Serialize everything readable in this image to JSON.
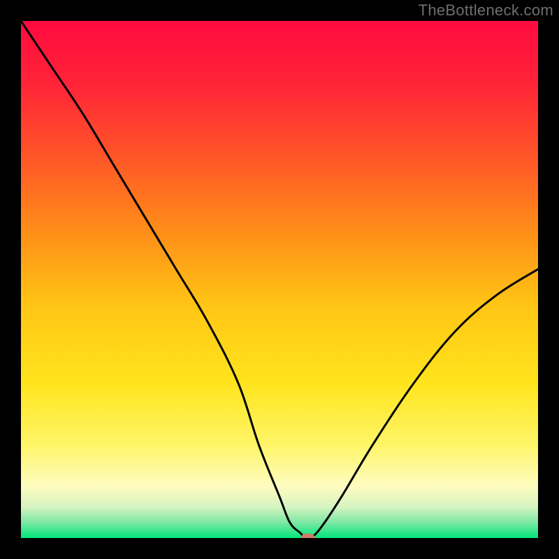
{
  "watermark": "TheBottleneck.com",
  "chart_data": {
    "type": "line",
    "title": "",
    "xlabel": "",
    "ylabel": "",
    "xlim": [
      0,
      100
    ],
    "ylim": [
      0,
      100
    ],
    "background_gradient": {
      "stops": [
        {
          "offset": 0.0,
          "color": "#ff0a3f"
        },
        {
          "offset": 0.12,
          "color": "#ff2338"
        },
        {
          "offset": 0.25,
          "color": "#ff5129"
        },
        {
          "offset": 0.4,
          "color": "#ff8b19"
        },
        {
          "offset": 0.55,
          "color": "#ffc515"
        },
        {
          "offset": 0.7,
          "color": "#ffe41c"
        },
        {
          "offset": 0.82,
          "color": "#fff568"
        },
        {
          "offset": 0.9,
          "color": "#fdfcc0"
        },
        {
          "offset": 0.94,
          "color": "#d6f4c1"
        },
        {
          "offset": 0.97,
          "color": "#7de7a3"
        },
        {
          "offset": 1.0,
          "color": "#00e67b"
        }
      ]
    },
    "series": [
      {
        "name": "curve",
        "x": [
          0,
          6,
          12,
          18,
          24,
          30,
          36,
          42,
          46,
          50,
          52,
          54,
          55,
          56,
          58,
          62,
          68,
          76,
          84,
          92,
          100
        ],
        "y": [
          100,
          91,
          82,
          72,
          62,
          52,
          42,
          30,
          18,
          8,
          3,
          1,
          0,
          0,
          2,
          8,
          18,
          30,
          40,
          47,
          52
        ]
      }
    ],
    "marker": {
      "x": 55.5,
      "y": 0,
      "rx": 1.4,
      "ry": 0.9,
      "color": "#cf7a6a"
    }
  }
}
